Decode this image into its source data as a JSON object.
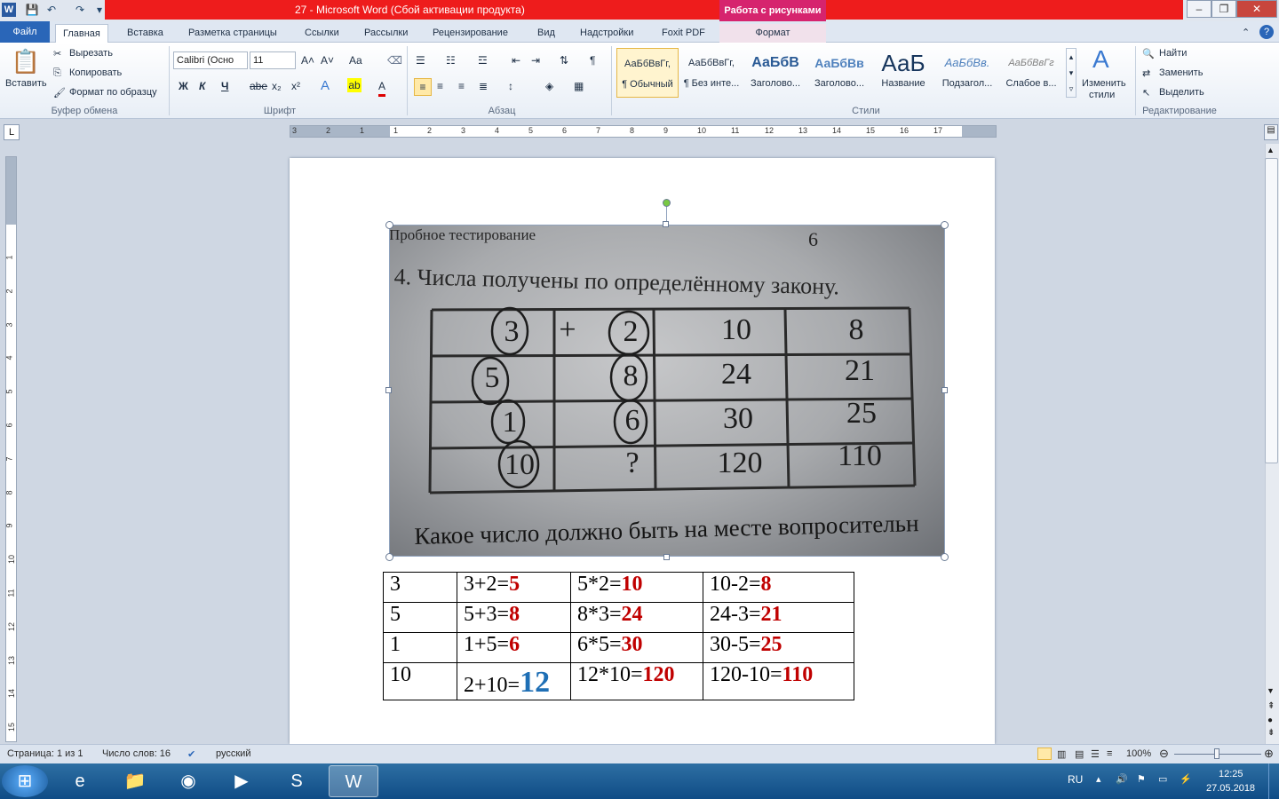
{
  "window": {
    "title": "27  -  Microsoft Word (Сбой активации продукта)",
    "context_group": "Работа с рисунками",
    "minimize": "–",
    "restore": "❐",
    "close": "✕"
  },
  "tabs": [
    "Файл",
    "Главная",
    "Вставка",
    "Разметка страницы",
    "Ссылки",
    "Рассылки",
    "Рецензирование",
    "Вид",
    "Надстройки",
    "Foxit PDF",
    "Формат"
  ],
  "clipboard": {
    "paste": "Вставить",
    "cut": "Вырезать",
    "copy": "Копировать",
    "format_painter": "Формат по образцу",
    "label": "Буфер обмена"
  },
  "font": {
    "name": "Calibri (Осно",
    "size": "11",
    "bold": "Ж",
    "italic": "К",
    "underline": "Ч",
    "strike": "abe",
    "sub": "x₂",
    "sup": "x²",
    "grow": "A˄",
    "shrink": "A˅",
    "case": "Aa",
    "label": "Шрифт"
  },
  "paragraph": {
    "label": "Абзац",
    "pilcrow": "¶"
  },
  "styles": {
    "label": "Стили",
    "items": [
      {
        "sample": "АаБбВвГг,",
        "name": "¶ Обычный"
      },
      {
        "sample": "АаБбВвГг,",
        "name": "¶ Без инте..."
      },
      {
        "sample": "АаБбВ",
        "name": "Заголово..."
      },
      {
        "sample": "АаБбВв",
        "name": "Заголово..."
      },
      {
        "sample": "АаБ",
        "name": "Название"
      },
      {
        "sample": "АаБбВв.",
        "name": "Подзагол..."
      },
      {
        "sample": "АаБбВвГг",
        "name": "Слабое в..."
      }
    ],
    "change": "Изменить",
    "change2": "стили"
  },
  "editing": {
    "find": "Найти",
    "replace": "Заменить",
    "select": "Выделить",
    "label": "Редактирование"
  },
  "ruler": {
    "h_ticks": [
      "3",
      "2",
      "1",
      "1",
      "2",
      "3",
      "4",
      "5",
      "6",
      "7",
      "8",
      "9",
      "10",
      "11",
      "12",
      "13",
      "14",
      "15",
      "16",
      "17"
    ],
    "v_ticks": [
      "1",
      "2",
      "3",
      "4",
      "5",
      "6",
      "7",
      "8",
      "9",
      "10",
      "11",
      "12",
      "13",
      "14",
      "15"
    ]
  },
  "photo": {
    "header_left": "Пробное тестирование",
    "header_right": "6",
    "question": "4. Числа получены по определённому закону.",
    "grid": [
      [
        "3",
        "+",
        "2",
        "10",
        "8"
      ],
      [
        "5",
        "",
        "8",
        "24",
        "21"
      ],
      [
        "1",
        "",
        "6",
        "30",
        "25"
      ],
      [
        "10",
        "",
        "?",
        "120",
        "110"
      ]
    ],
    "footer": "Какое число должно быть на месте вопросительн"
  },
  "table": [
    [
      {
        "t": "3"
      },
      {
        "t": "3+2=",
        "v": "5"
      },
      {
        "t": "5*2=",
        "v": "10"
      },
      {
        "t": "10-2=",
        "v": "8"
      }
    ],
    [
      {
        "t": "5"
      },
      {
        "t": "5+3=",
        "v": "8"
      },
      {
        "t": "8*3=",
        "v": "24"
      },
      {
        "t": "24-3=",
        "v": "21"
      }
    ],
    [
      {
        "t": "1"
      },
      {
        "t": "1+5=",
        "v": "6"
      },
      {
        "t": "6*5=",
        "v": "30"
      },
      {
        "t": "30-5=",
        "v": "25"
      }
    ],
    [
      {
        "t": "10"
      },
      {
        "t": "2+10=",
        "v": "12",
        "blue": true
      },
      {
        "t": "12*10=",
        "v": "120"
      },
      {
        "t": "120-10=",
        "v": "110"
      }
    ]
  ],
  "status": {
    "page": "Страница: 1 из 1",
    "words": "Число слов: 16",
    "lang": "русский",
    "zoom": "100%"
  },
  "tray": {
    "lang": "RU",
    "time": "12:25",
    "date": "27.05.2018"
  },
  "colors": {
    "accent_red": "#c00000",
    "accent_blue": "#1f6fb5",
    "title_red": "#ee1c1c",
    "context_pink": "#d6246e"
  }
}
